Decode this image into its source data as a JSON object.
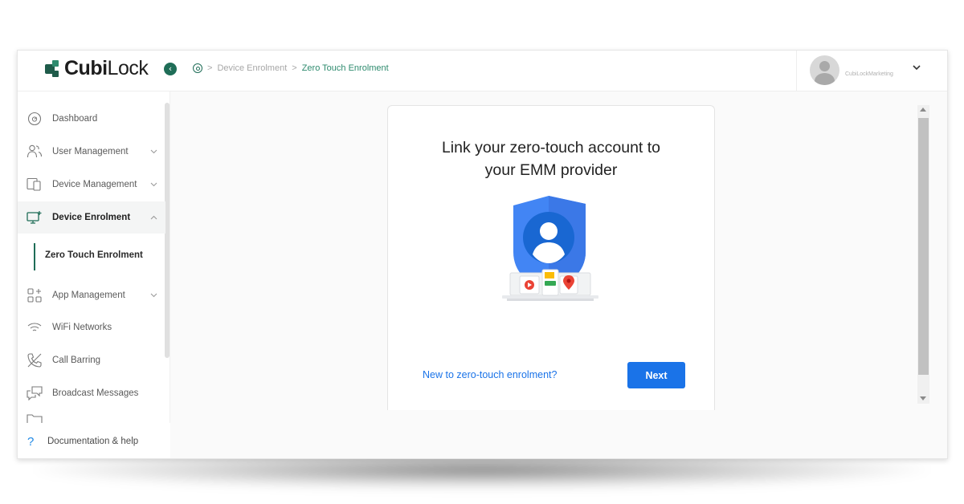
{
  "brand": {
    "name_bold": "Cubi",
    "name_rest": "Lock"
  },
  "header": {
    "collapse_icon": "chevron-left-icon",
    "breadcrumb": {
      "home_icon": "dashboard-icon",
      "separator": ">",
      "items": [
        "Device Enrolment",
        "Zero Touch Enrolment"
      ]
    },
    "user": {
      "name": "CubiLockMarketing",
      "menu_icon": "chevron-down-icon"
    }
  },
  "sidebar": {
    "items": [
      {
        "label": "Dashboard",
        "icon": "gauge-icon",
        "chevron": ""
      },
      {
        "label": "User Management",
        "icon": "users-icon",
        "chevron": "⌄"
      },
      {
        "label": "Device Management",
        "icon": "devices-icon",
        "chevron": "⌄"
      },
      {
        "label": "Device Enrolment",
        "icon": "monitor-add-icon",
        "chevron": "⌃"
      },
      {
        "label": "App Management",
        "icon": "apps-icon",
        "chevron": "⌄"
      },
      {
        "label": "WiFi Networks",
        "icon": "wifi-icon",
        "chevron": ""
      },
      {
        "label": "Call Barring",
        "icon": "phone-off-icon",
        "chevron": ""
      },
      {
        "label": "Broadcast Messages",
        "icon": "messages-icon",
        "chevron": ""
      }
    ],
    "sub_item": {
      "label": "Zero Touch Enrolment"
    },
    "footer": {
      "label": "Documentation & help",
      "icon": "?"
    }
  },
  "main": {
    "title_line1": "Link your zero-touch account to",
    "title_line2": "your EMM provider",
    "link_label": "New to zero-touch enrolment?",
    "next_label": "Next"
  },
  "colors": {
    "brand_green": "#1f6d57",
    "accent_blue": "#1a73e8",
    "shield_blue": "#4285f4"
  }
}
